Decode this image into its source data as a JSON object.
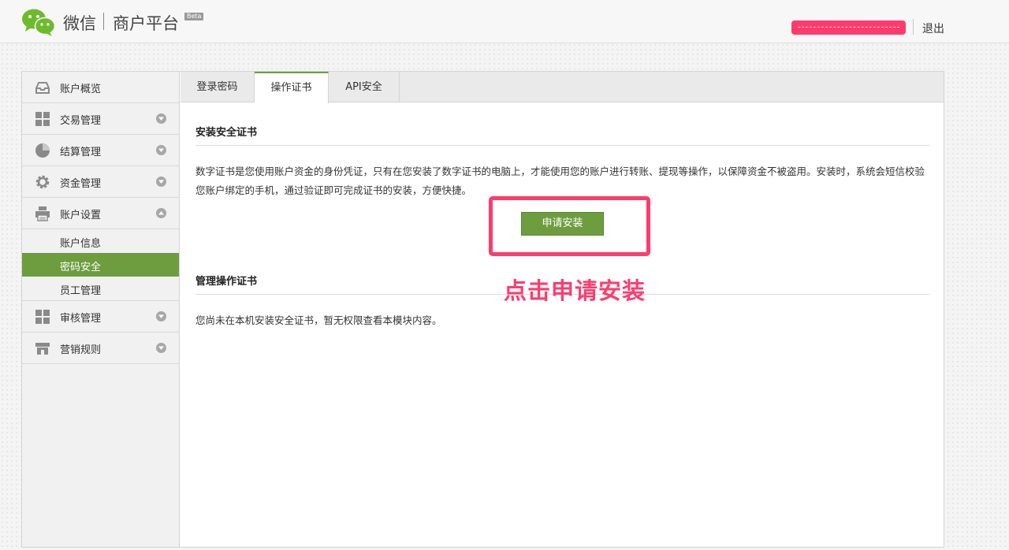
{
  "header": {
    "brand": "微信",
    "sub_brand": "商户平台",
    "beta_badge": "Beta",
    "logout_label": "退出"
  },
  "sidebar": {
    "items": [
      {
        "label": "账户概览",
        "icon": "inbox-icon"
      },
      {
        "label": "交易管理",
        "icon": "grid-icon"
      },
      {
        "label": "结算管理",
        "icon": "pie-chart-icon"
      },
      {
        "label": "资金管理",
        "icon": "gear-icon"
      },
      {
        "label": "账户设置",
        "icon": "printer-icon"
      },
      {
        "label": "审核管理",
        "icon": "grid-icon"
      },
      {
        "label": "营销规则",
        "icon": "store-icon"
      }
    ],
    "subitems": [
      {
        "label": "账户信息"
      },
      {
        "label": "密码安全"
      },
      {
        "label": "员工管理"
      }
    ]
  },
  "tabs": [
    {
      "label": "登录密码"
    },
    {
      "label": "操作证书"
    },
    {
      "label": "API安全"
    }
  ],
  "content": {
    "install_title": "安装安全证书",
    "description": "数字证书是您使用账户资金的身份凭证，只有在您安装了数字证书的电脑上，才能使用您的账户进行转账、提现等操作，以保障资金不被盗用。安装时，系统会短信校验您账户绑定的手机，通过验证即可完成证书的安装，方便快捷。",
    "apply_button": "申请安装",
    "manage_title": "管理操作证书",
    "manage_text": "您尚未在本机安装安全证书，暂无权限查看本模块内容。"
  },
  "annotation": {
    "text": "点击申请安装"
  },
  "colors": {
    "accent_green": "#6e9d3f",
    "highlight_pink": "#ff3b6e"
  }
}
